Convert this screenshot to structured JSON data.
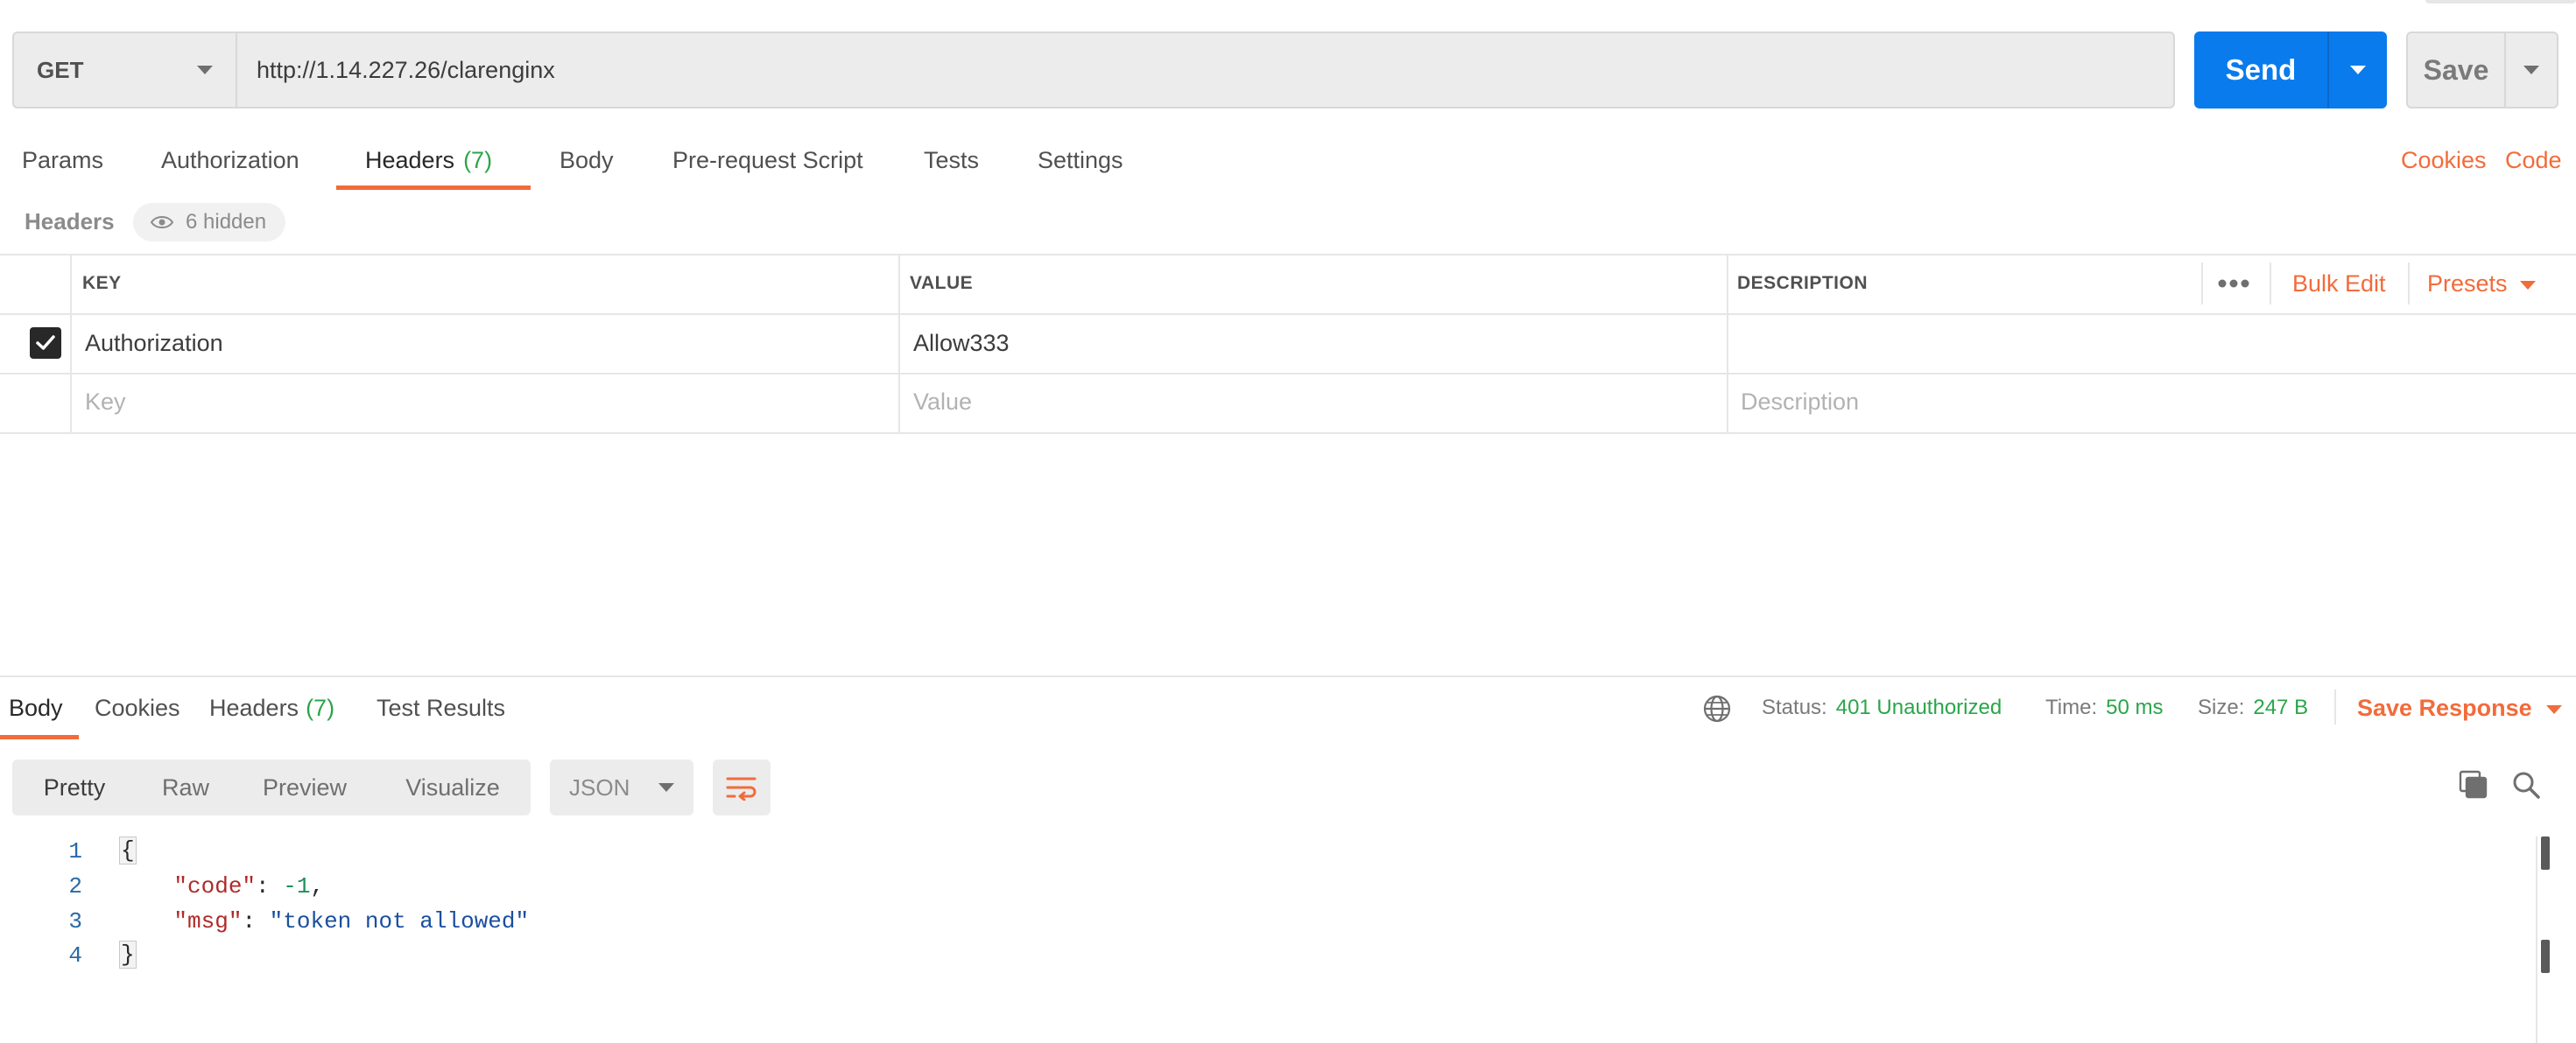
{
  "request": {
    "method": "GET",
    "url": "http://1.14.227.26/clarenginx",
    "send_label": "Send",
    "save_label": "Save"
  },
  "request_tabs": {
    "params": "Params",
    "authorization": "Authorization",
    "headers": "Headers",
    "headers_count": "(7)",
    "body": "Body",
    "prerequest": "Pre-request Script",
    "tests": "Tests",
    "settings": "Settings",
    "cookies": "Cookies",
    "code": "Code"
  },
  "headers_section": {
    "label": "Headers",
    "hidden": "6 hidden"
  },
  "headers_table": {
    "columns": {
      "key": "KEY",
      "value": "VALUE",
      "description": "DESCRIPTION"
    },
    "bulk_edit": "Bulk Edit",
    "presets": "Presets",
    "rows": [
      {
        "key": "Authorization",
        "value": "Allow333",
        "description": ""
      }
    ],
    "placeholders": {
      "key": "Key",
      "value": "Value",
      "description": "Description"
    }
  },
  "response_tabs": {
    "body": "Body",
    "cookies": "Cookies",
    "headers": "Headers",
    "headers_count": "(7)",
    "test_results": "Test Results"
  },
  "response_status": {
    "status_label": "Status:",
    "status_value": "401 Unauthorized",
    "time_label": "Time:",
    "time_value": "50 ms",
    "size_label": "Size:",
    "size_value": "247 B",
    "save_response": "Save Response"
  },
  "view_modes": {
    "pretty": "Pretty",
    "raw": "Raw",
    "preview": "Preview",
    "visualize": "Visualize"
  },
  "format": "JSON",
  "response_body": {
    "line_numbers": [
      "1",
      "2",
      "3",
      "4"
    ],
    "open_brace": "{",
    "close_brace": "}",
    "code_key": "\"code\"",
    "code_value": "-1",
    "msg_key": "\"msg\"",
    "msg_value": "\"token not allowed\""
  },
  "colors": {
    "accent_orange": "#f26b3a",
    "send_blue": "#097bed",
    "success_green": "#2aa54a"
  },
  "icons": [
    "chevron-down-icon",
    "eye-icon",
    "checkbox-checked-icon",
    "more-horizontal-icon",
    "globe-icon",
    "wrap-lines-icon",
    "copy-icon",
    "search-icon"
  ]
}
